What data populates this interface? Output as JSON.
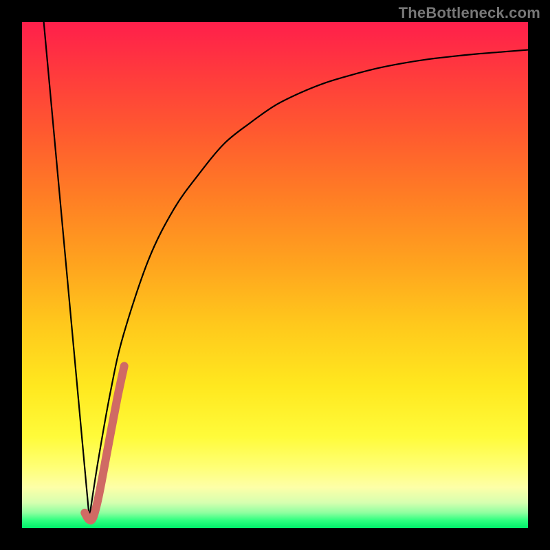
{
  "watermark": "TheBottleneck.com",
  "chart_data": {
    "type": "line",
    "title": "",
    "xlabel": "",
    "ylabel": "",
    "xlim": [
      0,
      100
    ],
    "ylim": [
      0,
      100
    ],
    "grid": false,
    "legend": false,
    "series": [
      {
        "name": "left-falling-line",
        "color": "#000000",
        "x": [
          4.3,
          13.3
        ],
        "values": [
          100,
          2
        ]
      },
      {
        "name": "rising-curve",
        "color": "#000000",
        "x": [
          13.3,
          15,
          17.5,
          20,
          25,
          30,
          35,
          40,
          45,
          50,
          55,
          60,
          65,
          70,
          75,
          80,
          85,
          90,
          95,
          100
        ],
        "values": [
          2,
          13,
          27,
          38,
          53,
          63,
          70,
          76,
          80,
          83.5,
          86,
          88,
          89.5,
          90.8,
          91.8,
          92.6,
          93.2,
          93.7,
          94.1,
          94.5
        ]
      },
      {
        "name": "highlight-j",
        "color": "#d06a64",
        "x": [
          12.4,
          13.3,
          14.1,
          15.2,
          17.0,
          18.8,
          20.2
        ],
        "values": [
          3.0,
          1.6,
          2.2,
          6.5,
          16.0,
          25.5,
          32.0
        ]
      }
    ],
    "background_gradient": {
      "orientation": "vertical",
      "stops": [
        {
          "pos": 0.0,
          "color": "#ff1f4b"
        },
        {
          "pos": 0.1,
          "color": "#ff3a3d"
        },
        {
          "pos": 0.22,
          "color": "#ff5a2f"
        },
        {
          "pos": 0.35,
          "color": "#ff7f24"
        },
        {
          "pos": 0.48,
          "color": "#ffa41e"
        },
        {
          "pos": 0.6,
          "color": "#ffc91c"
        },
        {
          "pos": 0.72,
          "color": "#ffe81f"
        },
        {
          "pos": 0.82,
          "color": "#fffb3a"
        },
        {
          "pos": 0.88,
          "color": "#ffff76"
        },
        {
          "pos": 0.92,
          "color": "#fdffa8"
        },
        {
          "pos": 0.95,
          "color": "#d6ffb0"
        },
        {
          "pos": 0.97,
          "color": "#8effa0"
        },
        {
          "pos": 0.985,
          "color": "#2eff7f"
        },
        {
          "pos": 1.0,
          "color": "#00ef6a"
        }
      ]
    }
  }
}
